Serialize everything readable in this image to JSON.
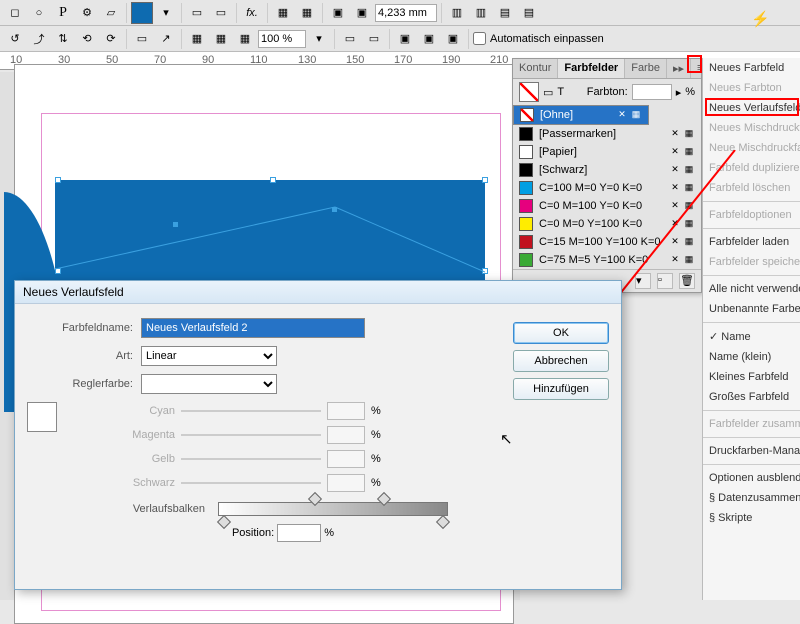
{
  "toolbar": {
    "percent": "100 %",
    "mm": "4,233 mm",
    "auto_fit": "Automatisch einpassen"
  },
  "ruler_ticks": [
    "10",
    "30",
    "50",
    "70",
    "90",
    "110",
    "130",
    "150",
    "170",
    "190",
    "210"
  ],
  "panel": {
    "tabs": {
      "kontur": "Kontur",
      "farbfelder": "Farbfelder",
      "farbe": "Farbe"
    },
    "tint_label": "Farbton:",
    "tint_unit": "%",
    "swatches": [
      {
        "name": "[Ohne]",
        "color": "#ffffff",
        "sel": true,
        "none": true
      },
      {
        "name": "[Passermarken]",
        "color": "#000000"
      },
      {
        "name": "[Papier]",
        "color": "#ffffff"
      },
      {
        "name": "[Schwarz]",
        "color": "#000000"
      },
      {
        "name": "C=100 M=0 Y=0 K=0",
        "color": "#009fe3"
      },
      {
        "name": "C=0 M=100 Y=0 K=0",
        "color": "#e6007e"
      },
      {
        "name": "C=0 M=0 Y=100 K=0",
        "color": "#ffed00"
      },
      {
        "name": "C=15 M=100 Y=100 K=0",
        "color": "#c1121f"
      },
      {
        "name": "C=75 M=5 Y=100 K=0",
        "color": "#3aaa35"
      }
    ]
  },
  "flyout": {
    "items": [
      {
        "label": "Neues Farbfeld",
        "disabled": false
      },
      {
        "label": "Neues Farbton",
        "disabled": true
      },
      {
        "label": "Neues Verlaufsfeld",
        "disabled": false,
        "hl": true
      },
      {
        "label": "Neues Mischdruckfarbfeld",
        "disabled": true
      },
      {
        "label": "Neue Mischdruckfarbgruppe",
        "disabled": true
      },
      {
        "label": "Farbfeld duplizieren",
        "disabled": true
      },
      {
        "label": "Farbfeld löschen",
        "disabled": true
      },
      {
        "sep": true
      },
      {
        "label": "Farbfeldoptionen",
        "disabled": true
      },
      {
        "sep": true
      },
      {
        "label": "Farbfelder laden",
        "disabled": false
      },
      {
        "label": "Farbfelder speichern",
        "disabled": true
      },
      {
        "sep": true
      },
      {
        "label": "Alle nicht verwendeten auswählen",
        "disabled": false
      },
      {
        "label": "Unbenannte Farben hinzufügen",
        "disabled": false
      },
      {
        "sep": true
      },
      {
        "label": "Name",
        "disabled": false,
        "check": true
      },
      {
        "label": "Name (klein)",
        "disabled": false
      },
      {
        "label": "Kleines Farbfeld",
        "disabled": false
      },
      {
        "label": "Großes Farbfeld",
        "disabled": false
      },
      {
        "sep": true
      },
      {
        "label": "Farbfelder zusammenführen",
        "disabled": true
      },
      {
        "sep": true
      },
      {
        "label": "Druckfarben-Manager",
        "disabled": false
      },
      {
        "sep": true
      },
      {
        "label": "Optionen ausblenden",
        "disabled": false
      },
      {
        "icon": true,
        "label": "Datenzusammenführung"
      },
      {
        "icon": true,
        "label": "Skripte"
      }
    ]
  },
  "dialog": {
    "title": "Neues Verlaufsfeld",
    "name_label": "Farbfeldname:",
    "name_value": "Neues Verlaufsfeld 2",
    "type_label": "Art:",
    "type_value": "Linear",
    "stopcolor_label": "Reglerfarbe:",
    "cmyk": {
      "c": "Cyan",
      "m": "Magenta",
      "y": "Gelb",
      "k": "Schwarz",
      "unit": "%"
    },
    "ramp_label": "Verlaufsbalken",
    "position_label": "Position:",
    "position_unit": "%",
    "buttons": {
      "ok": "OK",
      "cancel": "Abbrechen",
      "add": "Hinzufügen"
    }
  }
}
